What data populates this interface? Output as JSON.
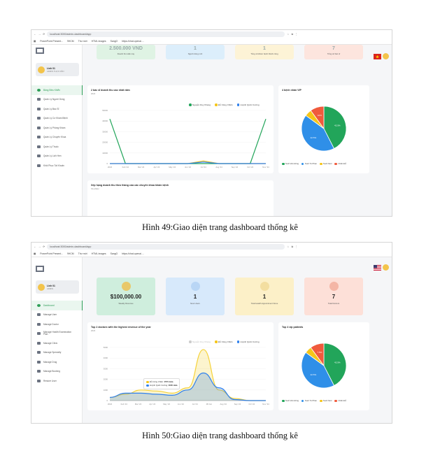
{
  "shot1": {
    "url": "localhost:3000/admin-dashboard/app",
    "bookmarks": [
      "PowerPoint Present...",
      "9HCM",
      "Thư mới",
      "HTML images",
      "SangO",
      "https://chat.openai...."
    ],
    "profile": {
      "name": "Linh 01",
      "role": "ADMIN THỰC DÂN"
    },
    "nav": [
      "Bảng Điều Khiển",
      "Quản Lý Người Dùng",
      "Quản Lý Bác Sĩ",
      "Quản Lý Cơ Khám Bệnh",
      "Quản Lý Phòng Khám",
      "Quản Lý Chuyên Khoa",
      "Quản Lý Thuốc",
      "Quản Lý Lịch Hẹn",
      "Khôi Phục Tài Khoản"
    ],
    "cards": [
      {
        "value": "2.500.000 VND",
        "label": "Doanh thu tuần này",
        "color": "#dff3e4"
      },
      {
        "value": "1",
        "label": "Người dùng mới",
        "color": "#dceefb"
      },
      {
        "value": "1",
        "label": "Tổng số khám bệnh thành công",
        "color": "#fdf3d6"
      },
      {
        "value": "7",
        "label": "Tổng số bác sĩ",
        "color": "#fde5de"
      }
    ],
    "chart_title": "2 bác sĩ doanh thu cao nhất năm",
    "chart_year": "2024",
    "legend": [
      "Nguyễn Duy Khang",
      "Đỗ Công Chiến",
      "Huỳnh Quốc Cường"
    ],
    "yticks": [
      "0",
      "10000",
      "20000",
      "30000",
      "40000",
      "50000"
    ],
    "xticks": [
      "2024",
      "Feb '24",
      "Mar '24",
      "Apr '24",
      "May '24",
      "Jun '24",
      "Jul '24",
      "Aug '24",
      "Sep '24",
      "Oct '24",
      "Nov '24"
    ],
    "pie_title": "4 bệnh nhân VIP",
    "pie_legend": [
      "Nuôi Văn Hồng",
      "Nuôi Tú Phan",
      "Nuôi Nuôi",
      "Chiến Đỗ"
    ],
    "bottom_title": "Xếp hạng doanh thu theo tháng của các chuyên khoa khám bệnh",
    "bottom_sub": "Số phiếu/",
    "caption": "Hình 49:Giao diện trang dashboard thống kê"
  },
  "shot2": {
    "url": "localhost:3000/admin-dashboard/app",
    "bookmarks": [
      "PowerPoint Present...",
      "9HCM",
      "Thư mới",
      "HTML images",
      "SangO",
      "https://chat.openai...."
    ],
    "profile": {
      "name": "Linh 01",
      "role": "ADMIN"
    },
    "nav": [
      "Dashboard",
      "Manage User",
      "Manage Doctor",
      "Manage Health Examination Plan",
      "Manage Clinic",
      "Manage Specialty",
      "Manage Drug",
      "Manage Booking",
      "Restore User"
    ],
    "cards": [
      {
        "value": "$100,000.00",
        "label": "Weekly Revenue",
        "color": "#cfeedd",
        "icon_bg": "#e8c86a"
      },
      {
        "value": "1",
        "label": "New Users",
        "color": "#d7e9fb",
        "icon_bg": "#b9d6f5"
      },
      {
        "value": "1",
        "label": "Total Health Appointment Done",
        "color": "#fcf0c8",
        "icon_bg": "#f3dea0"
      },
      {
        "value": "7",
        "label": "Total Doctors",
        "color": "#fde0d8",
        "icon_bg": "#f4b6a6"
      }
    ],
    "chart_title": "Top 2 doctors with the highest revenue of the year",
    "chart_year": "2024",
    "legend": [
      "Nguyễn Duy Khang",
      "Đỗ Công Chiến",
      "Huỳnh Quốc Cường"
    ],
    "yticks": [
      "0",
      "1000",
      "2000",
      "3000",
      "4000",
      "5000"
    ],
    "xticks": [
      "2024",
      "Feb '24",
      "Mar '24",
      "Apr '24",
      "May '24",
      "Jun '24",
      "Jul '24",
      "08 Jun",
      "Aug '24",
      "Sep '24",
      "Oct '24",
      "Nov '24"
    ],
    "tooltip": [
      {
        "name": "Đỗ Công Chiến",
        "value": "2570 data"
      },
      {
        "name": "Huỳnh Quốc Cường",
        "value": "3000 data"
      }
    ],
    "pie_title": "Top 4 vip patients",
    "pie_legend": [
      "Nuôi Văn Hồng",
      "Nuôi Tú Phan",
      "Nuôi Nuôi",
      "Chiến Đỗ"
    ],
    "caption": "Hình 50:Giao diện trang dashboard thống kê"
  },
  "chart_data": [
    {
      "type": "line",
      "title": "2 bác sĩ doanh thu cao nhất năm",
      "subtitle": "2024",
      "x": [
        "2024",
        "Feb '24",
        "Mar '24",
        "Apr '24",
        "May '24",
        "Jun '24",
        "Jul '24",
        "Aug '24",
        "Sep '24",
        "Oct '24",
        "Nov '24"
      ],
      "series": [
        {
          "name": "Nguyễn Duy Khang",
          "color": "#22a55a",
          "values": [
            42000,
            0,
            0,
            0,
            0,
            0,
            0,
            0,
            0,
            0,
            42000
          ]
        },
        {
          "name": "Đỗ Công Chiến",
          "color": "#f5c518",
          "values": [
            0,
            0,
            0,
            0,
            0,
            0,
            2500,
            0,
            0,
            0,
            0
          ]
        },
        {
          "name": "Huỳnh Quốc Cường",
          "color": "#2f80ed",
          "values": [
            0,
            0,
            0,
            0,
            0,
            0,
            1500,
            0,
            0,
            0,
            0
          ]
        }
      ],
      "ylim": [
        0,
        50000
      ]
    },
    {
      "type": "pie",
      "title": "4 bệnh nhân VIP",
      "categories": [
        "Nuôi Văn Hồng",
        "Nuôi Tú Phan",
        "Nuôi Nuôi",
        "Chiến Đỗ"
      ],
      "values": [
        42.5,
        42.5,
        5,
        10
      ],
      "labels": [
        "42.5%",
        "42.5%",
        "",
        "10%"
      ],
      "colors": [
        "#22a55a",
        "#2f8fe8",
        "#f5c518",
        "#f05a3c"
      ]
    },
    {
      "type": "area",
      "title": "Top 2 doctors with the highest revenue of the year",
      "subtitle": "2024",
      "x": [
        "2024",
        "Feb '24",
        "Mar '24",
        "Apr '24",
        "May '24",
        "Jun '24",
        "Jul '24",
        "Aug '24",
        "Sep '24",
        "Oct '24",
        "Nov '24"
      ],
      "series": [
        {
          "name": "Nguyễn Duy Khang",
          "color": "#c8c8c8",
          "values": [
            0,
            0,
            0,
            0,
            0,
            0,
            0,
            0,
            0,
            0,
            0
          ]
        },
        {
          "name": "Đỗ Công Chiến",
          "color": "#f5d23a",
          "values": [
            300,
            600,
            1000,
            900,
            700,
            1200,
            4800,
            1000,
            200,
            0,
            0
          ]
        },
        {
          "name": "Huỳnh Quốc Cường",
          "color": "#2f80ed",
          "values": [
            300,
            700,
            700,
            600,
            500,
            1000,
            2600,
            1200,
            100,
            0,
            0
          ]
        }
      ],
      "ylim": [
        0,
        5000
      ]
    },
    {
      "type": "pie",
      "title": "Top 4 vip patients",
      "categories": [
        "Nuôi Văn Hồng",
        "Nuôi Tú Phan",
        "Nuôi Nuôi",
        "Chiến Đỗ"
      ],
      "values": [
        42.5,
        42.5,
        5,
        10
      ],
      "labels": [
        "42.5%",
        "42.5%",
        "",
        "7.5%"
      ],
      "colors": [
        "#22a55a",
        "#2f8fe8",
        "#f5c518",
        "#f05a3c"
      ]
    }
  ]
}
